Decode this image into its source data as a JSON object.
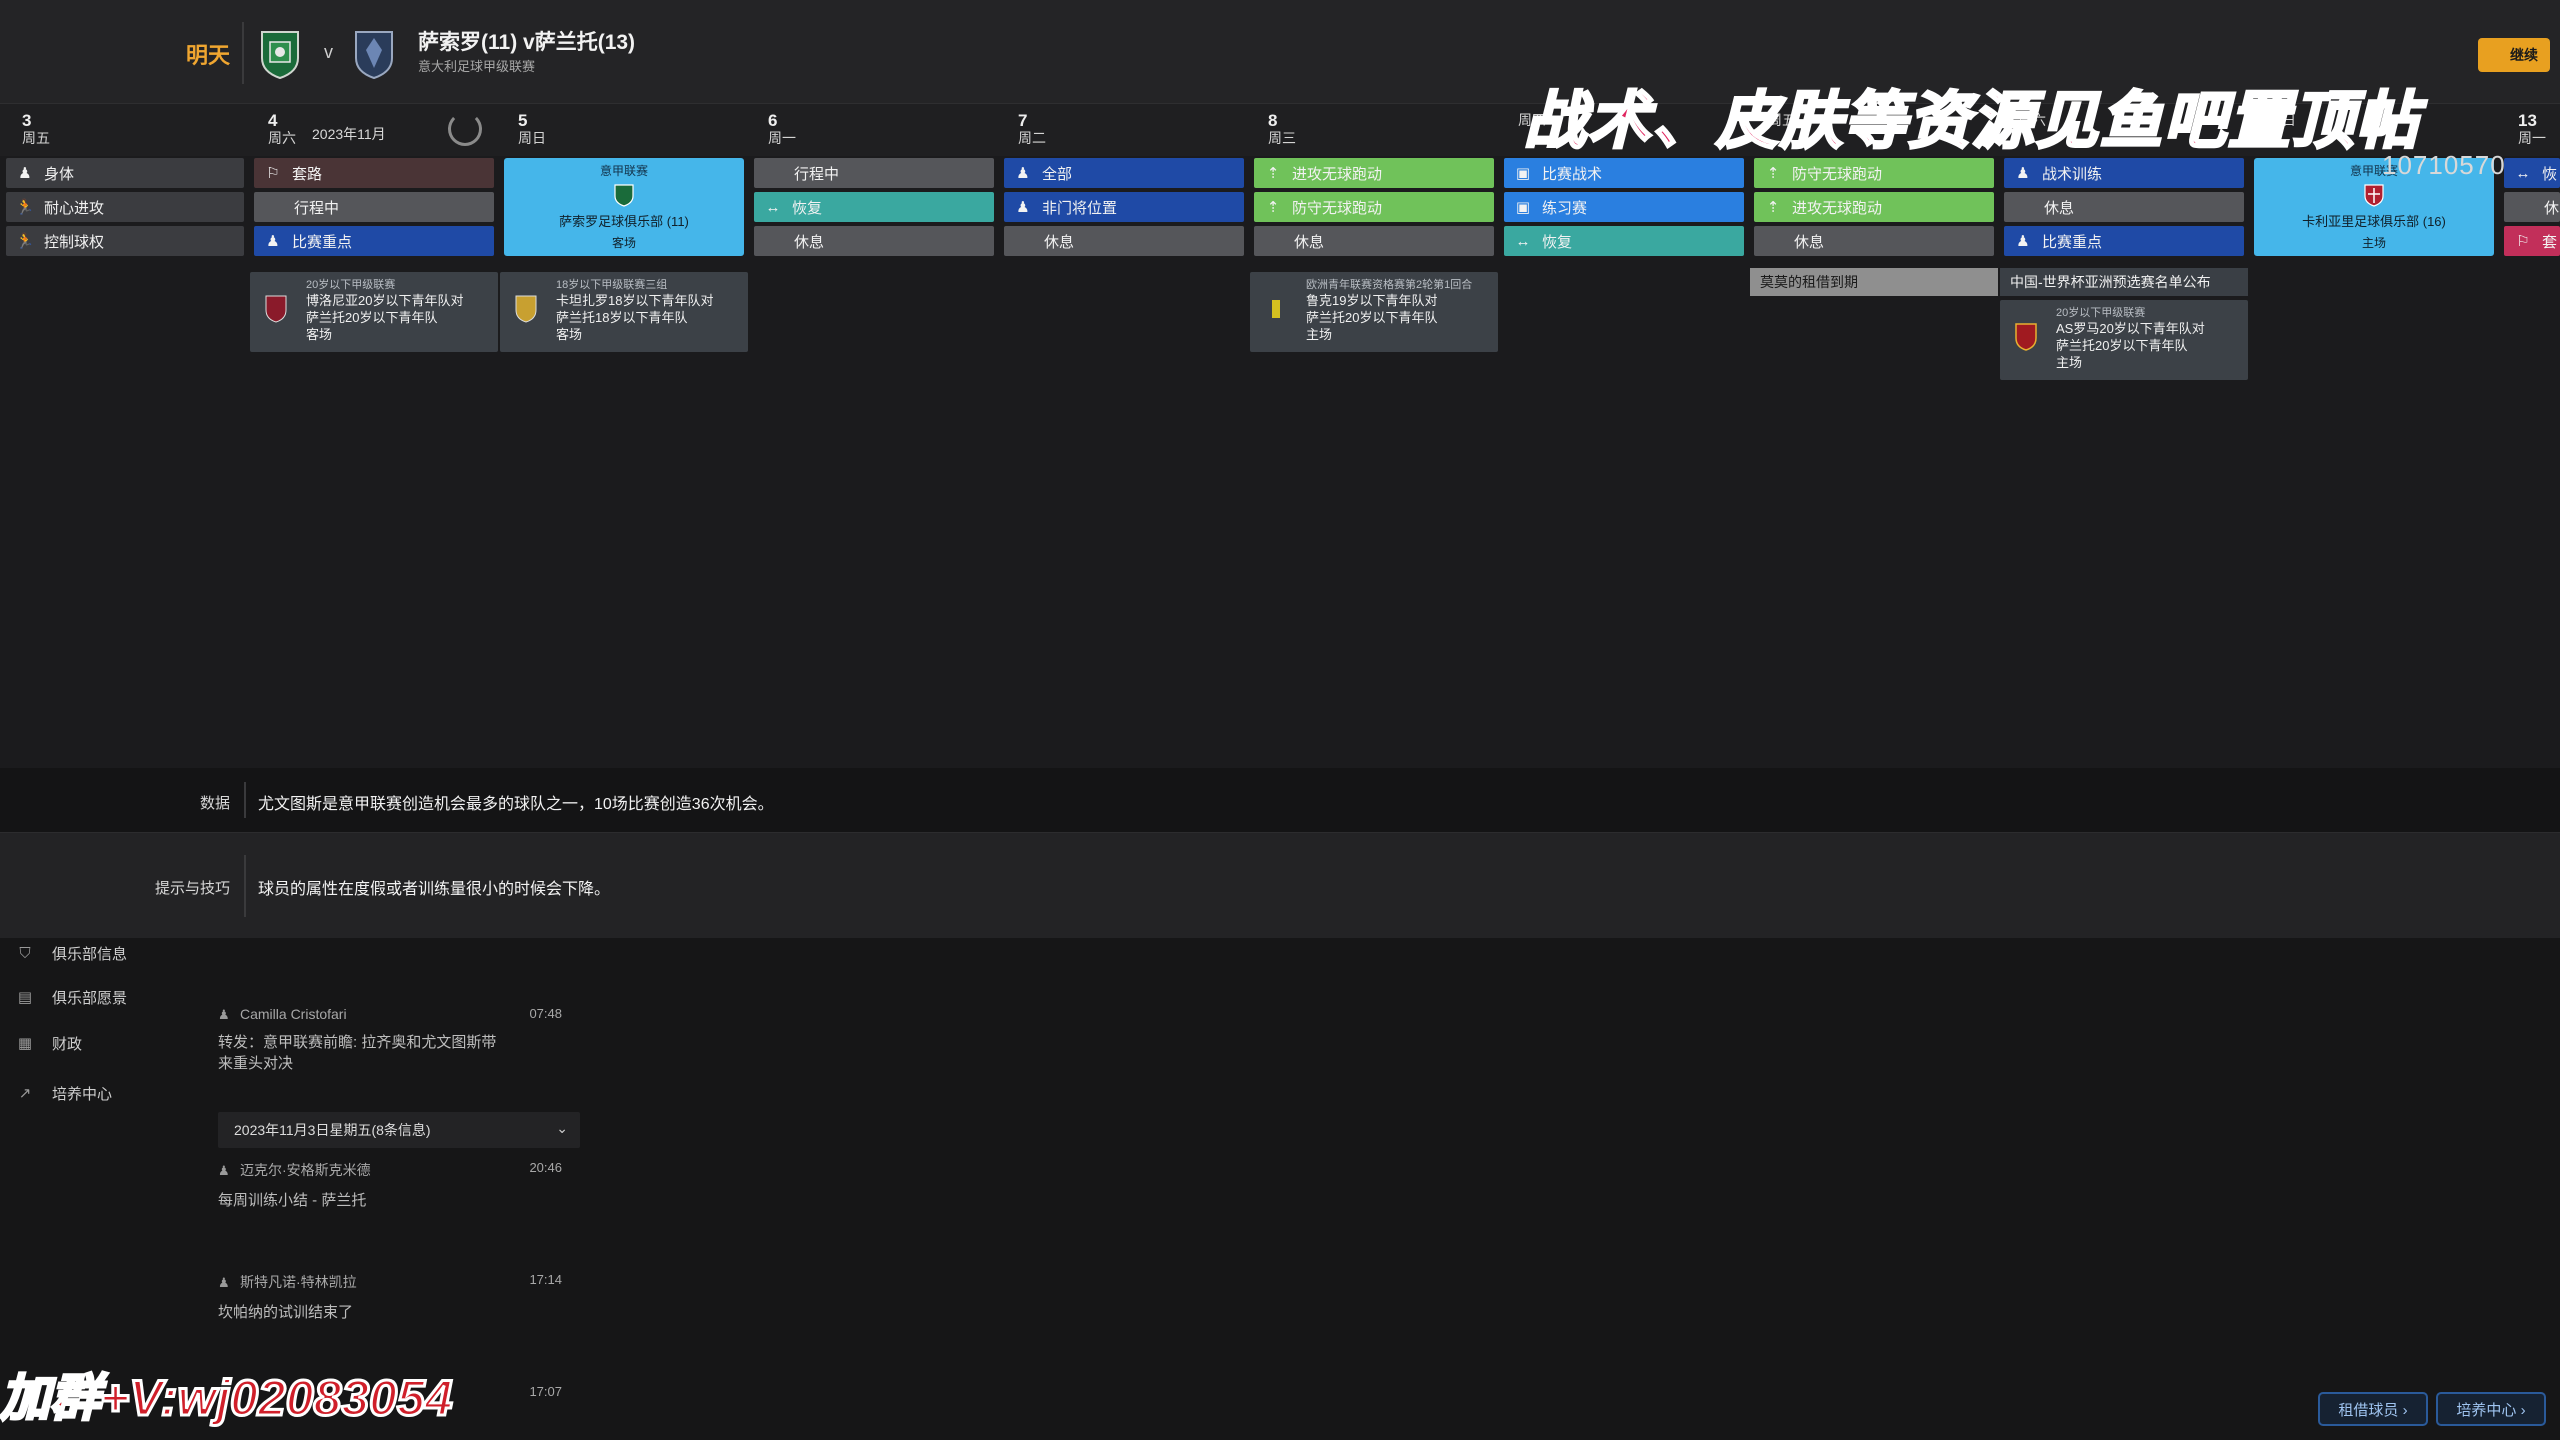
{
  "header": {
    "tomorrow_label": "明天",
    "vs": "v",
    "match_title": "萨索罗(11) v萨兰托(13)",
    "match_subtitle": "意大利足球甲级联赛",
    "top_right_label": "继续"
  },
  "calendar": {
    "month_label": "2023年11月",
    "days": [
      {
        "num": "3",
        "wd": "周五"
      },
      {
        "num": "4",
        "wd": "周六"
      },
      {
        "num": "5",
        "wd": "周日"
      },
      {
        "num": "6",
        "wd": "周一"
      },
      {
        "num": "7",
        "wd": "周二"
      },
      {
        "num": "8",
        "wd": "周三"
      },
      {
        "num": "",
        "wd": "周四"
      },
      {
        "num": "",
        "wd": "周五"
      },
      {
        "num": "",
        "wd": "周六"
      },
      {
        "num": "",
        "wd": "周日"
      },
      {
        "num": "13",
        "wd": "周一"
      }
    ],
    "col0": [
      "身体",
      "耐心进攻",
      "控制球权"
    ],
    "col1": [
      "套路",
      "行程中",
      "比赛重点"
    ],
    "col3": [
      "行程中",
      "恢复",
      "休息"
    ],
    "col4": [
      "全部",
      "非门将位置",
      "休息"
    ],
    "col5": [
      "进攻无球跑动",
      "防守无球跑动",
      "休息"
    ],
    "col6": [
      "比赛战术",
      "练习赛",
      "恢复"
    ],
    "col7": [
      "防守无球跑动",
      "进攻无球跑动",
      "休息"
    ],
    "col8": [
      "战术训练",
      "休息",
      "比赛重点"
    ],
    "col10": [
      "恢",
      "休",
      "套"
    ],
    "match5": {
      "league": "意甲联赛",
      "team": "萨索罗足球俱乐部 (11)",
      "ha": "客场"
    },
    "match9": {
      "league": "意甲联赛",
      "team": "卡利亚里足球俱乐部 (16)",
      "ha": "主场"
    },
    "events": [
      {
        "l1": "20岁以下甲级联赛",
        "l2": "博洛尼亚20岁以下青年队对",
        "l3": "萨兰托20岁以下青年队",
        "l4": "客场"
      },
      {
        "l1": "18岁以下甲级联赛三组",
        "l2": "卡坦扎罗18岁以下青年队对",
        "l3": "萨兰托18岁以下青年队",
        "l4": "客场"
      },
      {
        "l1": "欧洲青年联赛资格赛第2轮第1回合",
        "l2": "鲁克19岁以下青年队对",
        "l3": "萨兰托20岁以下青年队",
        "l4": "主场"
      },
      {
        "l1": "20岁以下甲级联赛",
        "l2": "AS罗马20岁以下青年队对",
        "l3": "萨兰托20岁以下青年队",
        "l4": "主场"
      }
    ],
    "notes": [
      "莫莫的租借到期",
      "中国-世界杯亚洲预选赛名单公布"
    ]
  },
  "info": {
    "data_label": "数据",
    "data_text": "尤文图斯是意甲联赛创造机会最多的球队之一，10场比赛创造36次机会。",
    "tip_label": "提示与技巧",
    "tip_text": "球员的属性在度假或者训练量很小的时候会下降。"
  },
  "sidebar": {
    "items": [
      "俱乐部信息",
      "俱乐部愿景",
      "财政",
      "培养中心"
    ]
  },
  "messages": {
    "m1": {
      "sender": "Camilla Cristofari",
      "time": "07:48",
      "body1": "转发：意甲联赛前瞻: 拉齐奥和尤文图斯带",
      "body2": "来重头对决"
    },
    "group": "2023年11月3日星期五(8条信息)",
    "m2": {
      "sender": "迈克尔·安格斯克米德",
      "time": "20:46",
      "body1": "每周训练小结 - 萨兰托"
    },
    "m3": {
      "sender": "斯特凡诺·特林凯拉",
      "time": "17:14",
      "body1": "坎帕纳的试训结束了"
    },
    "m4": {
      "time": "17:07"
    }
  },
  "buttons": {
    "loan": "租借球员 ›",
    "dev": "培养中心 ›"
  },
  "overlays": {
    "top_text": "战术、皮肤等资源见鱼吧置顶帖",
    "top_id": "10710570",
    "bottom_text": "加群+V:wj02083054"
  },
  "colors": {
    "accent": "#f0a630",
    "match_cell": "#45b6ea",
    "training_green": "#70c25a",
    "training_blue": "#1f4aa6"
  }
}
